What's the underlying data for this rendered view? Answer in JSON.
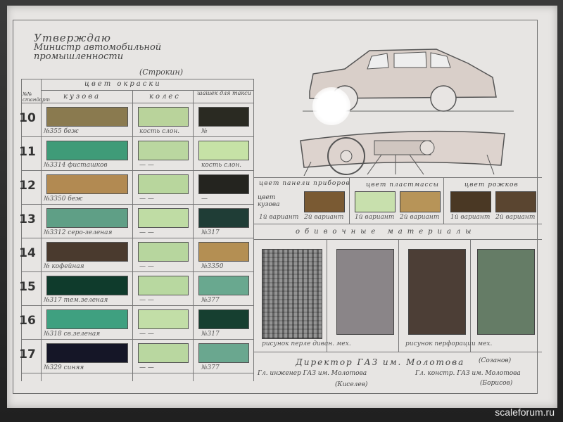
{
  "approval": {
    "line1": "Утверждаю",
    "line2": "Министр автомобильной",
    "line3": "промышленности",
    "signature": "(Строкин)"
  },
  "table_headers": {
    "row_label": "№№ стандарт",
    "paint_color": "цвет окраски",
    "body": "кузова",
    "wheels": "колес",
    "taxi_line": "шашек для такси"
  },
  "rows": [
    {
      "num": "10",
      "body_color": "#8a7a4f",
      "body_caption": "№355  беж",
      "wheel_color": "#b9d39b",
      "wheel_caption": "кость слон.",
      "taxi_color": "#2a2a22",
      "taxi_caption": "№"
    },
    {
      "num": "11",
      "body_color": "#3f9b78",
      "body_caption": "№3314  фисташков",
      "wheel_color": "#bad7a0",
      "wheel_caption": "—  —",
      "taxi_color": "#c6e2a6",
      "taxi_caption": "кость слон."
    },
    {
      "num": "12",
      "body_color": "#b28a52",
      "body_caption": "№3350  беж",
      "wheel_color": "#b8d69d",
      "wheel_caption": "—  —",
      "taxi_color": "#24241f",
      "taxi_caption": "—"
    },
    {
      "num": "13",
      "body_color": "#5f9f86",
      "body_caption": "№3312  серо-зеленая",
      "wheel_color": "#bfdca4",
      "wheel_caption": "—  —",
      "taxi_color": "#1f3d36",
      "taxi_caption": "№317"
    },
    {
      "num": "14",
      "body_color": "#4a3a2e",
      "body_caption": "№  кофейная",
      "wheel_color": "#b7d69e",
      "wheel_caption": "—  —",
      "taxi_color": "#b48f53",
      "taxi_caption": "№3350"
    },
    {
      "num": "15",
      "body_color": "#0f3b2c",
      "body_caption": "№317  тем.зеленая",
      "wheel_color": "#b8d8a0",
      "wheel_caption": "—  —",
      "taxi_color": "#69a88f",
      "taxi_caption": "№377"
    },
    {
      "num": "16",
      "body_color": "#3fa080",
      "body_caption": "№318  св.зеленая",
      "wheel_color": "#c2dea7",
      "wheel_caption": "—  —",
      "taxi_color": "#163f30",
      "taxi_caption": "№317"
    },
    {
      "num": "17",
      "body_color": "#151627",
      "body_caption": "№329  синяя",
      "wheel_color": "#b9d7a0",
      "wheel_caption": "—  —",
      "taxi_color": "#6aa78f",
      "taxi_caption": "№377"
    }
  ],
  "interior": {
    "dash_panel_header": "цвет панели приборов",
    "body_color_label": "цвет кузова",
    "plastic_header": "цвет пластмассы",
    "horn_header": "цвет рожков",
    "variant1": "1й вариант",
    "variant2": "2й вариант",
    "dash_colors": [
      "#7a5a33",
      "#c8e0ad",
      "#b79458"
    ],
    "horn_colors": [
      "#4a3824",
      "#5a4530"
    ]
  },
  "upholstery": {
    "header": "обивочные материалы",
    "samples": [
      {
        "color": "#8c8c8c",
        "caption": "рисунок перле диван. мех."
      },
      {
        "color": "#8a8588",
        "caption": ""
      },
      {
        "color": "#4c3e36",
        "caption": "рисунок перфорации мех."
      },
      {
        "color": "#657c66",
        "caption": ""
      }
    ]
  },
  "signatures": {
    "director": "Директор ГАЗ им. Молотова",
    "director_name": "(Созанов)",
    "engineer": "Гл. инженер ГАЗ им. Молотова",
    "engineer_name": "(Киселев)",
    "designer": "Гл. констр. ГАЗ им. Молотова",
    "designer_name": "(Борисов)"
  },
  "watermark": "scaleforum.ru"
}
